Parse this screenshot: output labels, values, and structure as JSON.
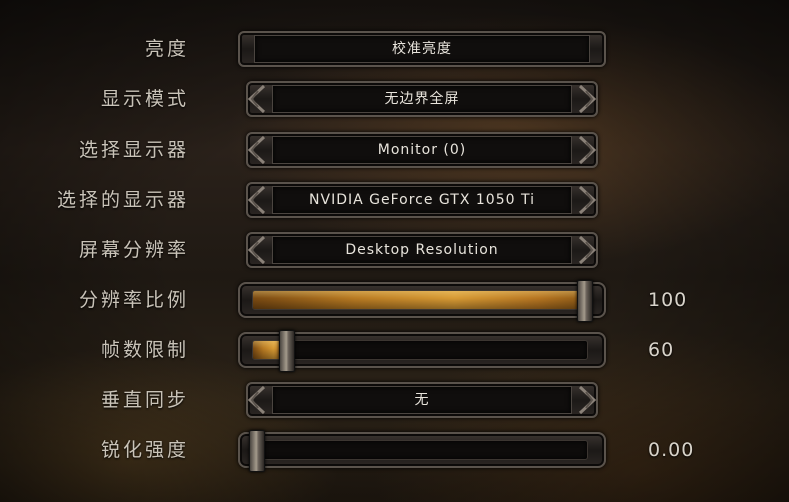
{
  "settings": [
    {
      "label": "亮度",
      "type": "button",
      "value": "校准亮度"
    },
    {
      "label": "显示模式",
      "type": "selector",
      "value": "无边界全屏"
    },
    {
      "label": "选择显示器",
      "type": "selector",
      "value": "Monitor (0)"
    },
    {
      "label": "选择的显示器",
      "type": "selector",
      "value": "NVIDIA GeForce GTX 1050 Ti"
    },
    {
      "label": "屏幕分辨率",
      "type": "selector",
      "value": "Desktop Resolution"
    },
    {
      "label": "分辨率比例",
      "type": "slider",
      "value": "100",
      "fraction": 1.0
    },
    {
      "label": "帧数限制",
      "type": "slider",
      "value": "60",
      "fraction": 0.1
    },
    {
      "label": "垂直同步",
      "type": "selector",
      "value": "无"
    },
    {
      "label": "锐化强度",
      "type": "slider",
      "value": "0.00",
      "fraction": 0.0
    }
  ],
  "colors": {
    "accent": "#d79a34",
    "text": "#c9c3b8",
    "frame": "#5a534c"
  },
  "icons": {
    "left": "arrow-left-icon",
    "right": "arrow-right-icon"
  }
}
